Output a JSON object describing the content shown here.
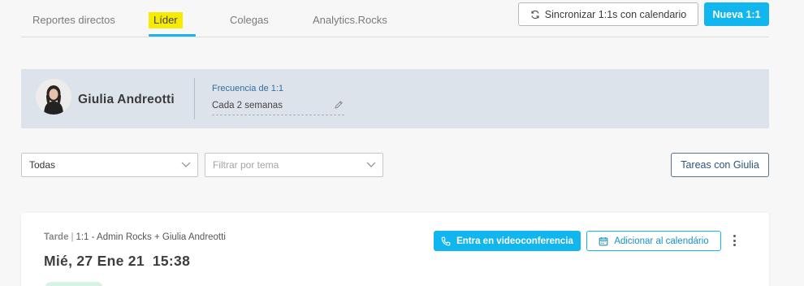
{
  "tabs": [
    {
      "label": "Reportes directos"
    },
    {
      "label": "Líder"
    },
    {
      "label": "Colegas"
    },
    {
      "label": "Analytics.Rocks"
    }
  ],
  "actions": {
    "sync_label": "Sincronizar 1:1s con calendario",
    "new_label": "Nueva 1:1"
  },
  "profile": {
    "name": "Giulia Andreotti",
    "frequency_label": "Frecuencia de 1:1",
    "frequency_value": "Cada 2 semanas"
  },
  "filters": {
    "scope_selected": "Todas",
    "topic_placeholder": "Filtrar por tema",
    "tasks_label": "Tareas con Giulia"
  },
  "meeting": {
    "period": "Tarde",
    "separator": "|",
    "title": "1:1 - Admin Rocks + Giulia Andreotti",
    "date": "Mié, 27 Ene 21",
    "time": "15:38",
    "video_label": "Entra en videoconferencia",
    "calendar_label": "Adicionar al calendário"
  },
  "colors": {
    "accent": "#12b6ef",
    "highlight": "#f7ec00",
    "profile_bg": "#dde3ea",
    "tasks_border": "#54718f"
  },
  "icons": [
    "sync-icon",
    "pencil-icon",
    "chevron-down-icon",
    "phone-icon",
    "calendar-icon",
    "kebab-menu-icon"
  ]
}
